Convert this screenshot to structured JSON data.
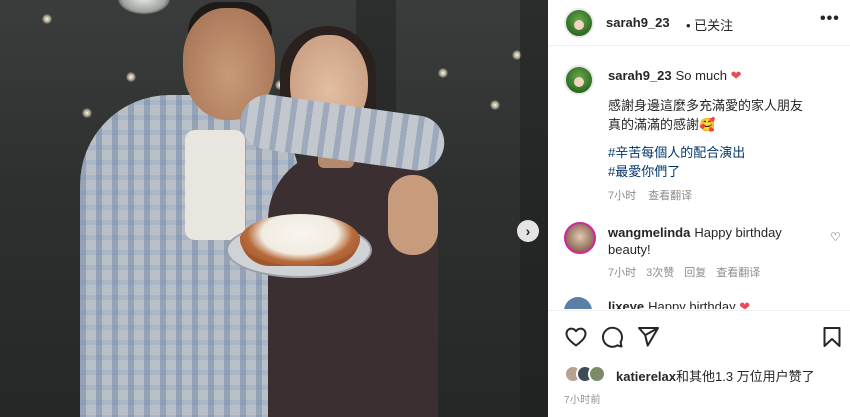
{
  "header": {
    "username": "sarah9_23",
    "follow_status": "• 已关注",
    "more_icon": "•••"
  },
  "caption": {
    "username": "sarah9_23",
    "text": "So much",
    "heart": "❤",
    "lines": [
      "感謝身邊這麼多充滿愛的家人朋友",
      "真的滿滿的感謝🥰"
    ],
    "hashtags": [
      "#辛苦每個人的配合演出",
      "#最愛你們了"
    ],
    "time": "7小时",
    "see_translation": "查看翻译"
  },
  "comments": [
    {
      "username": "wangmelinda",
      "text": "Happy birthday beauty!",
      "time": "7小时",
      "likes": "3次赞",
      "reply": "回复",
      "see_translation": "查看翻译",
      "heart": "♡"
    },
    {
      "username": "lixeye",
      "text": "Happy birthday",
      "heart": "❤"
    }
  ],
  "photo": {
    "next_icon": "›"
  },
  "likes": {
    "user": "katierelax",
    "rest": "和其他1.3 万位用户赞了"
  },
  "post_time": "7小时前",
  "colors": {
    "heart": "#ed4956",
    "hashtag": "#00376b",
    "meta": "#8e8e8e"
  }
}
